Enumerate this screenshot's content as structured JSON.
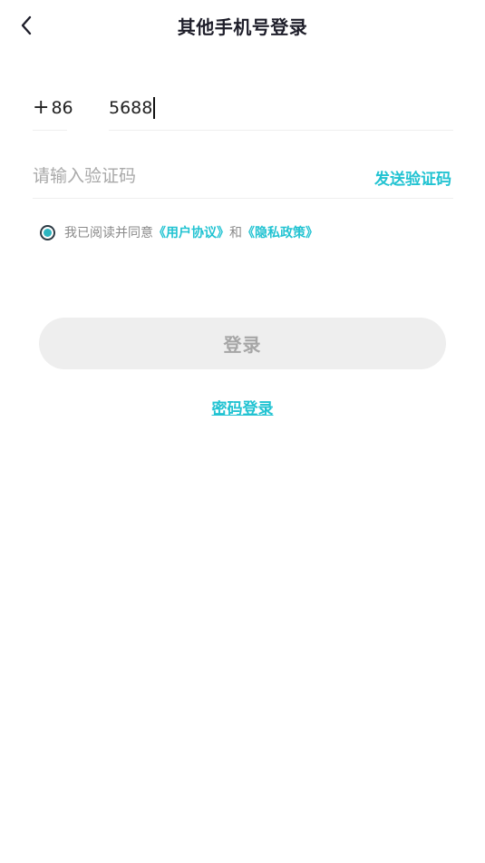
{
  "header": {
    "title": "其他手机号登录",
    "back_icon": "chevron-left-icon"
  },
  "phone": {
    "country_code_prefix": "+",
    "country_code": "86",
    "value": "5688"
  },
  "verification": {
    "placeholder": "请输入验证码",
    "send_code_label": "发送验证码"
  },
  "agreement": {
    "prefix": "我已阅读并同意",
    "user_agreement": "《用户协议》",
    "conjunction": "和",
    "privacy_policy": "《隐私政策》",
    "checked": true
  },
  "actions": {
    "login_label": "登录",
    "password_login_label": "密码登录"
  },
  "colors": {
    "accent": "#22c3d2",
    "button_disabled_bg": "#eeeeee",
    "button_disabled_text": "#a6a6a6",
    "title": "#1e1e2a"
  }
}
